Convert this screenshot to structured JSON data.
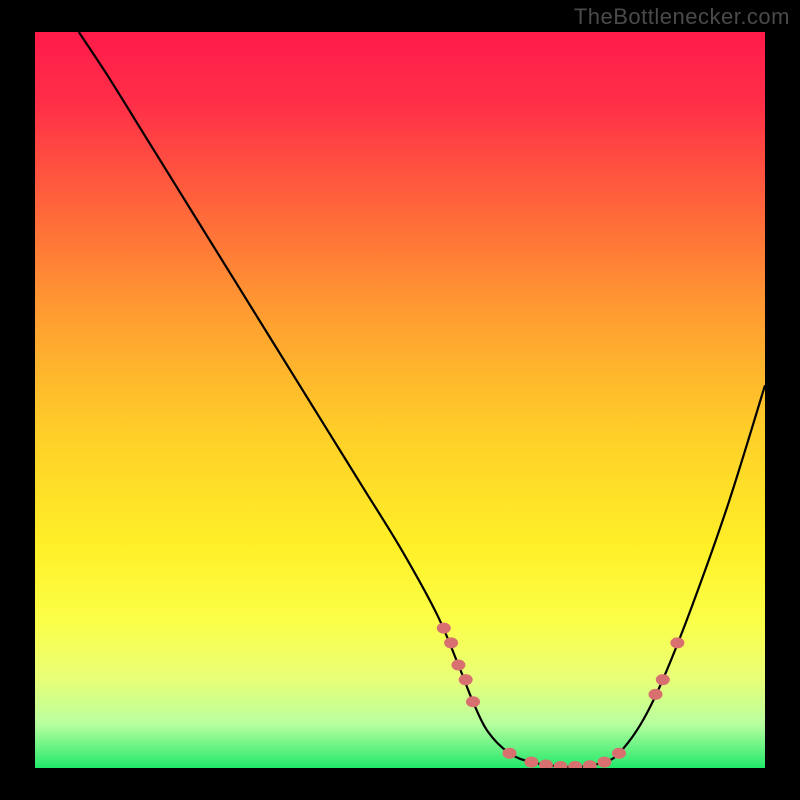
{
  "watermark": "TheBottlenecker.com",
  "chart_data": {
    "type": "line",
    "title": "",
    "xlabel": "",
    "ylabel": "",
    "xlim": [
      0,
      100
    ],
    "ylim": [
      0,
      100
    ],
    "background_gradient": {
      "stops": [
        {
          "offset": 0.0,
          "color": "#ff1a4a"
        },
        {
          "offset": 0.1,
          "color": "#ff3048"
        },
        {
          "offset": 0.25,
          "color": "#ff6a3a"
        },
        {
          "offset": 0.4,
          "color": "#ffa330"
        },
        {
          "offset": 0.55,
          "color": "#ffd028"
        },
        {
          "offset": 0.7,
          "color": "#fff028"
        },
        {
          "offset": 0.8,
          "color": "#fbff48"
        },
        {
          "offset": 0.88,
          "color": "#e8ff78"
        },
        {
          "offset": 0.94,
          "color": "#b8ffa0"
        },
        {
          "offset": 1.0,
          "color": "#22e86a"
        }
      ]
    },
    "series": [
      {
        "name": "bottleneck-curve",
        "type": "line",
        "color": "#000000",
        "x": [
          6,
          10,
          15,
          20,
          25,
          30,
          35,
          40,
          45,
          50,
          55,
          58,
          60,
          62,
          65,
          68,
          72,
          75,
          78,
          80,
          83,
          86,
          90,
          95,
          100
        ],
        "y": [
          100,
          94,
          86,
          78,
          70,
          62,
          54,
          46,
          38,
          30,
          21,
          14,
          9,
          5,
          2,
          0.8,
          0.2,
          0.2,
          0.8,
          2,
          6,
          12,
          22,
          36,
          52
        ]
      },
      {
        "name": "markers",
        "type": "scatter",
        "color": "#d97070",
        "x": [
          56,
          57,
          58,
          59,
          60,
          65,
          68,
          70,
          72,
          74,
          76,
          78,
          80,
          85,
          86,
          88
        ],
        "y": [
          19,
          17,
          14,
          12,
          9,
          2,
          0.8,
          0.4,
          0.2,
          0.2,
          0.3,
          0.8,
          2,
          10,
          12,
          17
        ]
      }
    ]
  }
}
